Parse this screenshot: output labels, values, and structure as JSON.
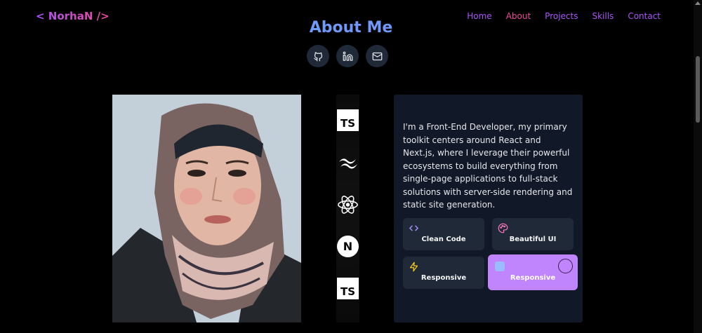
{
  "header": {
    "logo": "< NorhaN />",
    "nav": [
      {
        "label": "Home",
        "active": false
      },
      {
        "label": "About",
        "active": true
      },
      {
        "label": "Projects",
        "active": false
      },
      {
        "label": "Skills",
        "active": false
      },
      {
        "label": "Contact",
        "active": false
      }
    ]
  },
  "about": {
    "title": "About Me",
    "socials": [
      "github-icon",
      "linkedin-icon",
      "mail-icon"
    ],
    "tech_stack": [
      {
        "icon": "typescript-icon",
        "text": "TS"
      },
      {
        "icon": "tailwind-icon",
        "text": ""
      },
      {
        "icon": "react-icon",
        "text": ""
      },
      {
        "icon": "nextjs-icon",
        "text": "N"
      },
      {
        "icon": "typescript-icon",
        "text": "TS"
      }
    ],
    "bio": "I'm a Front-End Developer, my primary toolkit centers around React and Next.js, where I leverage their powerful ecosystems to build everything from single-page applications to full-stack solutions with server-side rendering and static site generation.",
    "features": [
      {
        "label": "Clean Code",
        "icon": "code-icon",
        "color": "#a78bfa"
      },
      {
        "label": "Beautiful UI",
        "icon": "palette-icon",
        "color": "#f472b6"
      },
      {
        "label": "Responsive",
        "icon": "lightning-icon",
        "color": "#facc15"
      },
      {
        "label": "Responsive",
        "icon": "device-icon",
        "color": "#93c5fd"
      }
    ]
  },
  "colors": {
    "accent_purple": "#a855f7",
    "accent_pink": "#ec4899",
    "card_bg": "#111827",
    "highlight": "#c084fc"
  }
}
